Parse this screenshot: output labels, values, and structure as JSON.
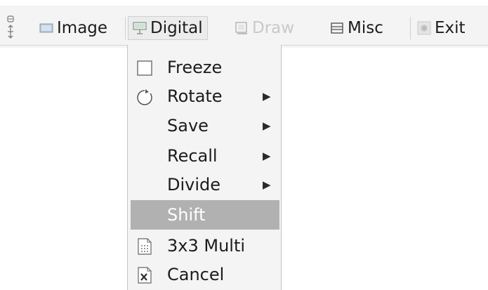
{
  "toolbar": {
    "items": [
      {
        "label": "Image",
        "icon": "image-icon",
        "state": "normal"
      },
      {
        "label": "Digital",
        "icon": "digital-icon",
        "state": "active"
      },
      {
        "label": "Draw",
        "icon": "draw-icon",
        "state": "disabled"
      },
      {
        "label": "Misc",
        "icon": "misc-icon",
        "state": "normal"
      },
      {
        "label": "Exit",
        "icon": "exit-icon",
        "state": "normal"
      }
    ]
  },
  "menu": {
    "items": [
      {
        "label": "Freeze",
        "icon": "checkbox-icon",
        "submenu": false,
        "selected": false
      },
      {
        "label": "Rotate",
        "icon": "rotate-icon",
        "submenu": true,
        "selected": false
      },
      {
        "label": "Save",
        "icon": "",
        "submenu": true,
        "selected": false
      },
      {
        "label": "Recall",
        "icon": "",
        "submenu": true,
        "selected": false
      },
      {
        "label": "Divide",
        "icon": "",
        "submenu": true,
        "selected": false
      },
      {
        "label": "Shift",
        "icon": "",
        "submenu": false,
        "selected": true
      },
      {
        "label": "3x3 Multi",
        "icon": "grid-icon",
        "submenu": false,
        "selected": false
      },
      {
        "label": "Cancel",
        "icon": "cancel-icon",
        "submenu": false,
        "selected": false
      }
    ],
    "submenu_arrow": "▶"
  },
  "colors": {
    "toolbar_bg": "#f4f4f4",
    "menu_bg": "#f4f4f4",
    "selected_bg": "#b1b1b1",
    "disabled_text": "#c9c9c9"
  }
}
